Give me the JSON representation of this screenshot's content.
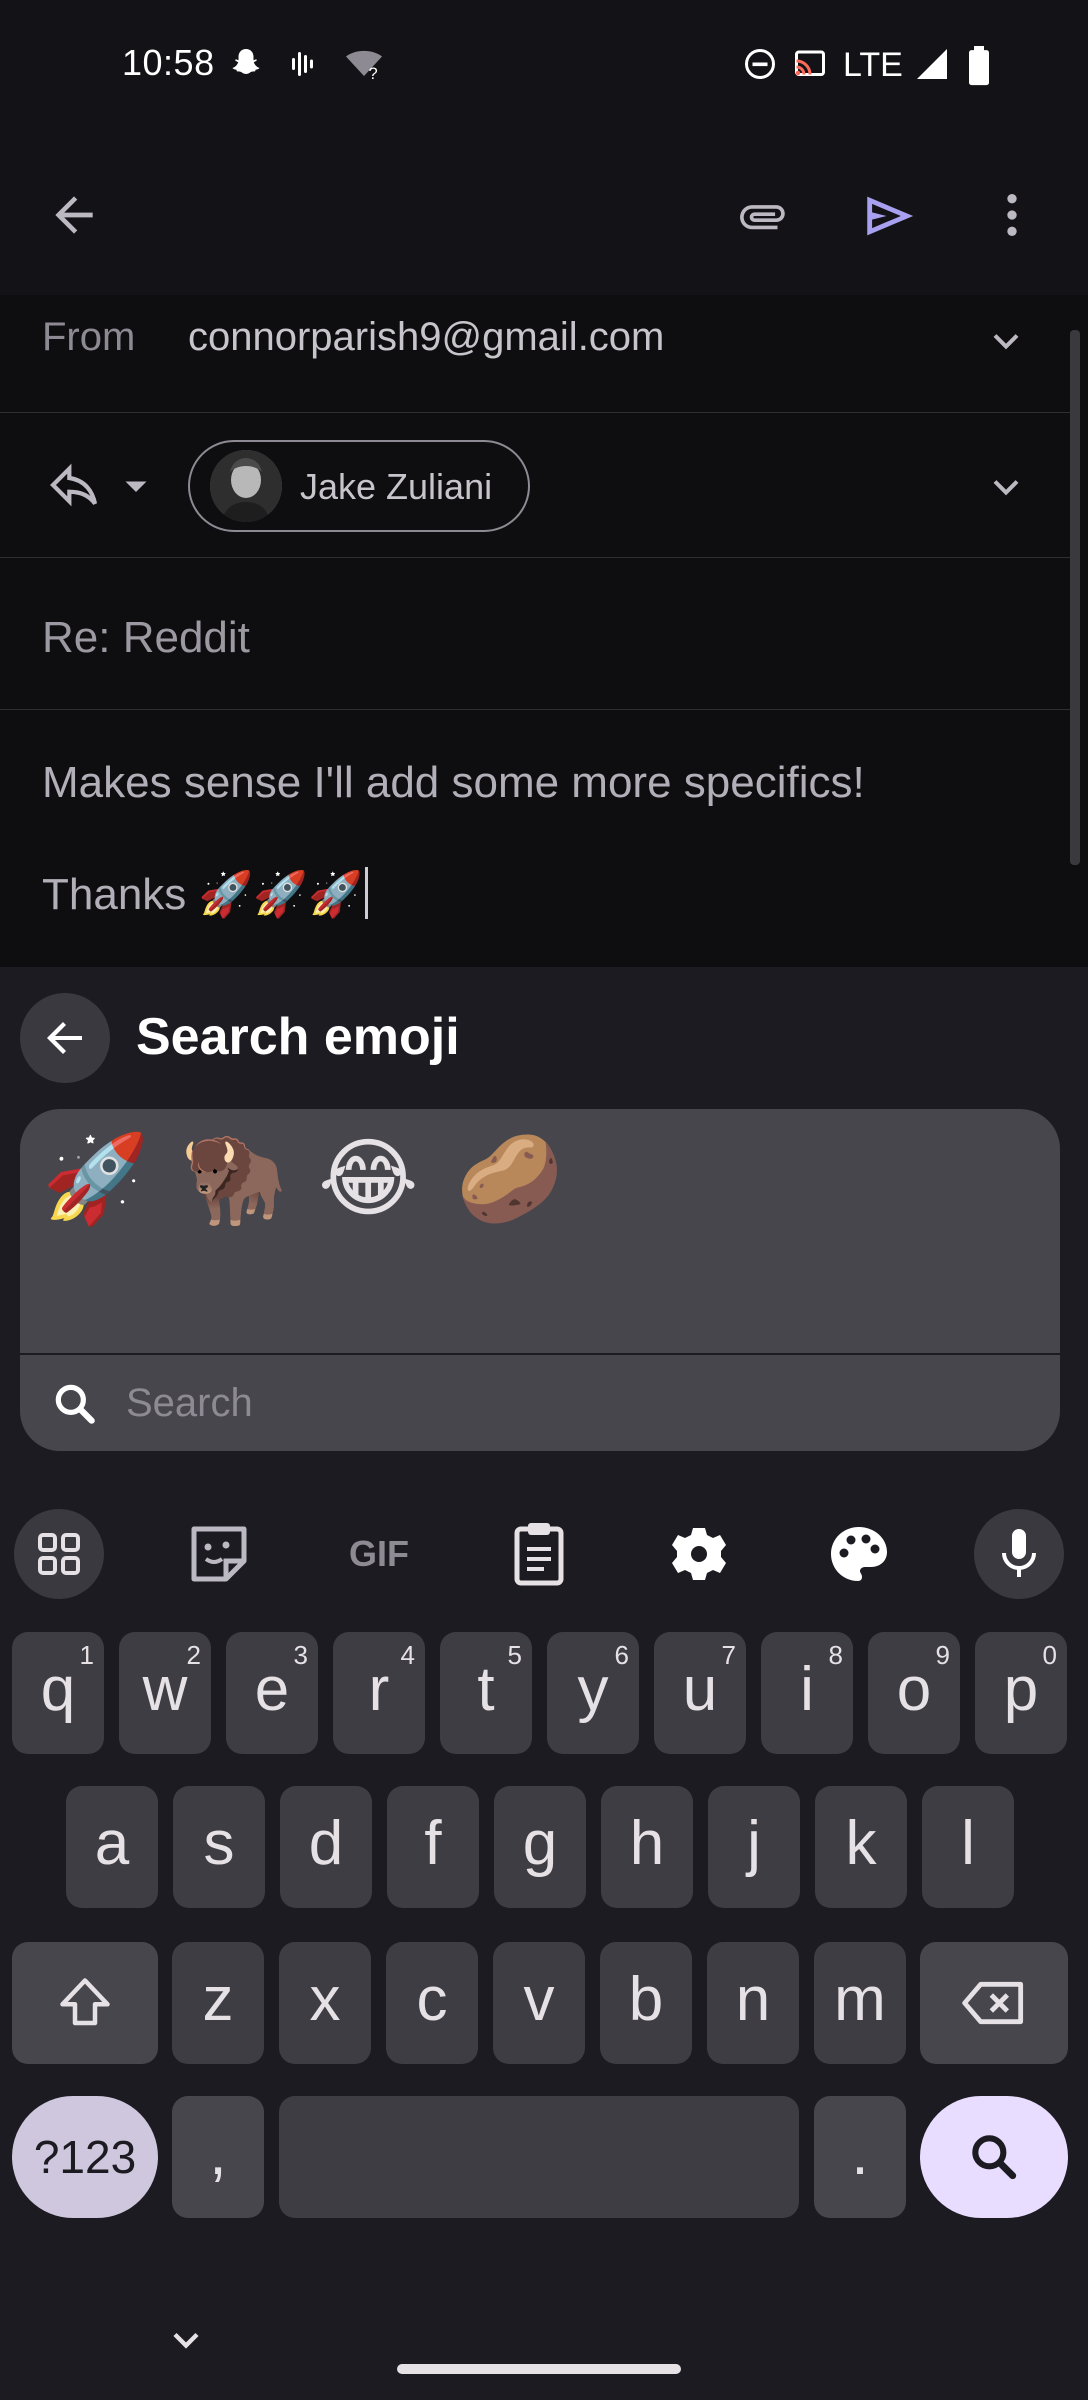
{
  "status_bar": {
    "time": "10:58",
    "network": "LTE",
    "icons_left": [
      "snapchat-icon",
      "voicemail-icon",
      "wifi-unknown-icon"
    ],
    "icons_right": [
      "do-not-disturb-icon",
      "cast-icon",
      "signal-icon",
      "battery-icon"
    ]
  },
  "app_bar": {
    "icons": [
      "back-arrow-icon",
      "attachment-icon",
      "send-icon",
      "more-vert-icon"
    ]
  },
  "compose": {
    "from_label": "From",
    "from_value": "connorparish9@gmail.com",
    "recipient_name": "Jake Zuliani",
    "subject": "Re: Reddit",
    "body_line1": "Makes sense I'll add some more specifics!",
    "body_line2": "Thanks 🚀🚀🚀"
  },
  "emoji_search": {
    "title": "Search emoji",
    "recent_emojis": [
      "🚀",
      "🦬",
      "😂",
      "🥔"
    ],
    "search_placeholder": "Search"
  },
  "keyboard": {
    "toolbar": [
      "grid-icon",
      "sticker-icon",
      "GIF",
      "clipboard-icon",
      "settings-icon",
      "palette-icon",
      "mic-icon"
    ],
    "gif_label": "GIF",
    "row1": [
      {
        "ch": "q",
        "num": "1"
      },
      {
        "ch": "w",
        "num": "2"
      },
      {
        "ch": "e",
        "num": "3"
      },
      {
        "ch": "r",
        "num": "4"
      },
      {
        "ch": "t",
        "num": "5"
      },
      {
        "ch": "y",
        "num": "6"
      },
      {
        "ch": "u",
        "num": "7"
      },
      {
        "ch": "i",
        "num": "8"
      },
      {
        "ch": "o",
        "num": "9"
      },
      {
        "ch": "p",
        "num": "0"
      }
    ],
    "row2": [
      "a",
      "s",
      "d",
      "f",
      "g",
      "h",
      "j",
      "k",
      "l"
    ],
    "row3": [
      "z",
      "x",
      "c",
      "v",
      "b",
      "n",
      "m"
    ],
    "symbols_label": "?123",
    "comma": ",",
    "period": "."
  },
  "colors": {
    "accent": "#a8a0f0",
    "enter_key": "#e9ddff",
    "symbols_key": "#cfc7dd",
    "key_bg": "#3e3d43"
  }
}
